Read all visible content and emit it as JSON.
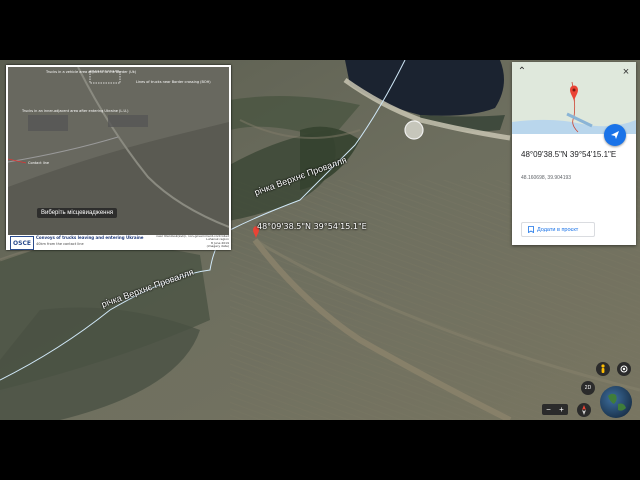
{
  "map": {
    "rivers": [
      {
        "label": "річка Верхнє Провалля"
      },
      {
        "label": "річка Верхнє Провалля"
      }
    ],
    "pin_label": "48°09'38.5\"N 39°54'15.1\"E",
    "tooltip": "Виберіть місцевиадження",
    "colors": {
      "pin": "#ea4335",
      "water": "#1b2330",
      "terrain": "#6b6c5c",
      "river_line": "#cfe7f7"
    }
  },
  "inset": {
    "logo": "OSCE",
    "caption_title": "Convoys of trucks leaving and entering Ukraine",
    "caption_subtitle": "40km from the contact line",
    "meta_line1": "near Uleniivsk(avk)i, non-government-controlled",
    "meta_line2": "Luhansk region",
    "meta_line3": "8 June 2019",
    "meta_line4": "(imagery date)",
    "annotations": [
      "Trucks in a vehicle area adjacent to the Border (Uk)",
      "Lines of trucks near Border crossing (BOH)",
      "Trucks in an inner-adjacent area after entering Ukraine (L.U.)",
      "Contact line"
    ]
  },
  "info_panel": {
    "dms": "48°09'38.5\"N 39°54'15.1\"E",
    "decimal": "48.160698, 39.904193",
    "add_button": "Додати в проєкт",
    "icons": {
      "close": "close-icon",
      "back": "chevron-up-icon",
      "navigate": "directions-icon",
      "add": "bookmark-icon"
    }
  },
  "controls": {
    "view_mode": "2D",
    "zoom_minus": "−",
    "zoom_plus": "+"
  }
}
